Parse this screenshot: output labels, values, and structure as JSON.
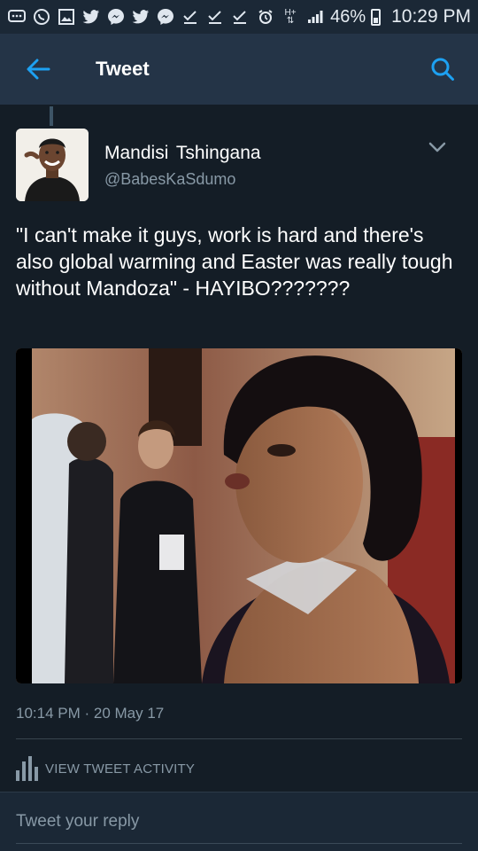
{
  "status_bar": {
    "notification_icons": [
      "chat-icon",
      "whatsapp-icon",
      "gallery-icon",
      "twitter-icon",
      "messenger-icon",
      "twitter-icon",
      "messenger-icon",
      "download-done-icon",
      "download-done-icon",
      "download-done-icon"
    ],
    "battery": "46%",
    "time": "10:29 PM"
  },
  "header": {
    "title": "Tweet"
  },
  "tweet": {
    "author_name": "Mandisi  Tshingana",
    "author_handle": "@BabesKaSdumo",
    "text": "\"I can't make it guys, work is hard and there's also global warming and Easter was really tough without Mandoza\" - HAYIBO???????",
    "timestamp": "10:14 PM · 20 May 17"
  },
  "activity": {
    "label": "VIEW TWEET ACTIVITY"
  },
  "reply": {
    "placeholder": "Tweet your reply"
  },
  "colors": {
    "background": "#141d26",
    "header": "#243447",
    "accent": "#1da1f2",
    "secondary_text": "#8899a6"
  }
}
